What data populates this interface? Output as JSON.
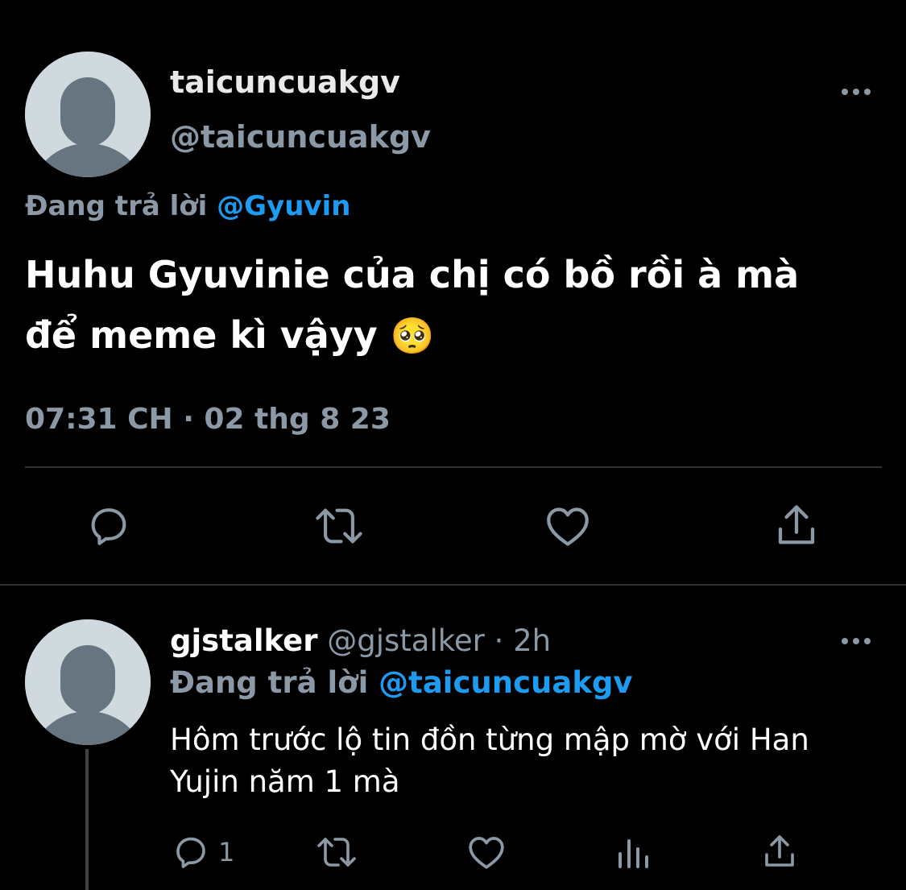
{
  "main_tweet": {
    "display_name": "taicuncuakgv",
    "handle": "@taicuncuakgv",
    "reply_prefix": "Đang trả lời",
    "reply_to": "@Gyuvin",
    "text_line1": "Huhu Gyuvinie của chị có bồ rồi à mà",
    "text_line2": "để meme kì vậyy",
    "emoji": "🥺",
    "timestamp": "07:31 CH · 02 thg 8 23"
  },
  "reply_tweet": {
    "display_name": "gjstalker",
    "handle": "@gjstalker",
    "separator": "·",
    "time_ago": "2h",
    "reply_prefix": "Đang trả lời",
    "reply_to": "@taicuncuakgv",
    "text_line1": "Hôm trước lộ tin đồn từng mập mờ với Han",
    "text_line2": "Yujin năm 1 mà",
    "reply_count": "1"
  },
  "colors": {
    "background": "#000000",
    "text": "#e7e9ea",
    "muted": "#8b98a5",
    "link": "#1d9bf0",
    "divider": "#2f3336"
  },
  "icons": {
    "more": "more-icon",
    "reply": "reply-icon",
    "retweet": "retweet-icon",
    "like": "like-icon",
    "share": "share-icon",
    "analytics": "analytics-icon",
    "emoji": "pleading-face-emoji"
  }
}
